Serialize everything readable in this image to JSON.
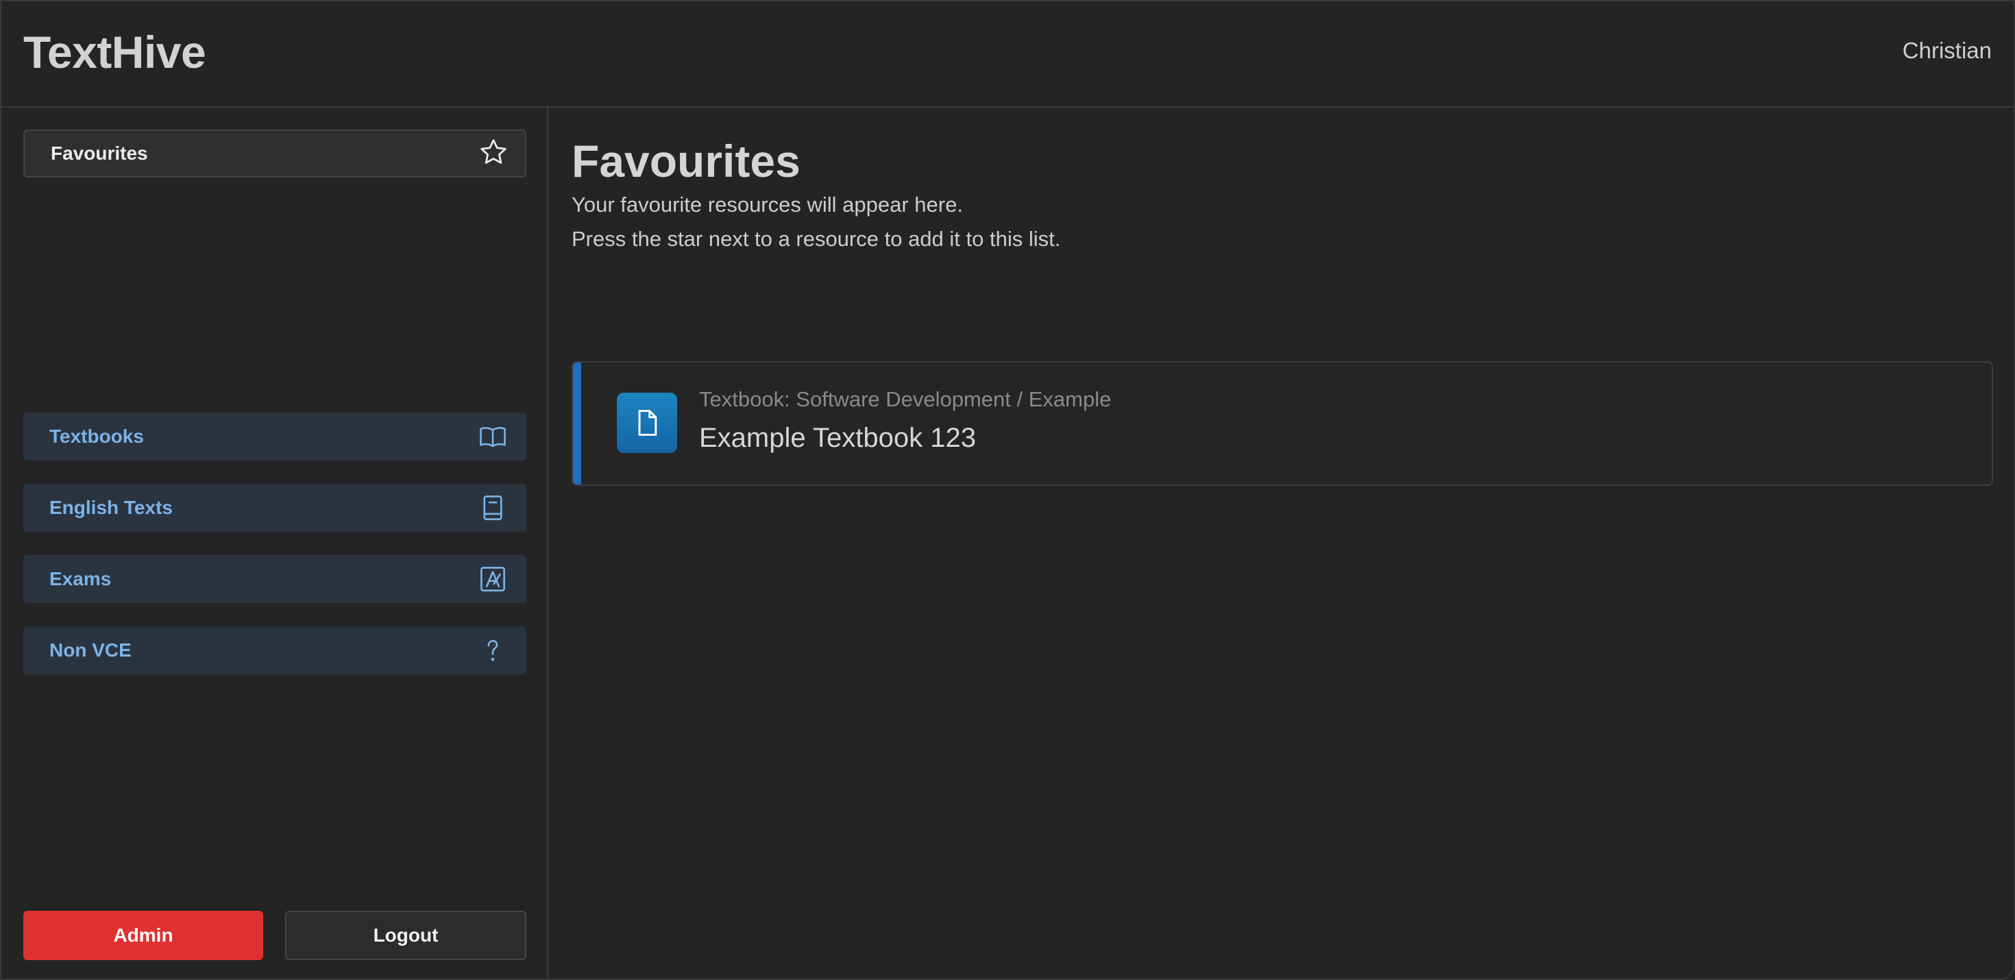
{
  "header": {
    "brand": "TextHive",
    "user_name": "Christian"
  },
  "sidebar": {
    "favourites_label": "Favourites",
    "items": [
      {
        "label": "Textbooks",
        "icon": "book-open-icon"
      },
      {
        "label": "English Texts",
        "icon": "book-icon"
      },
      {
        "label": "Exams",
        "icon": "exam-icon"
      },
      {
        "label": "Non VCE",
        "icon": "question-icon"
      }
    ],
    "admin_label": "Admin",
    "logout_label": "Logout"
  },
  "main": {
    "title": "Favourites",
    "description_lines": [
      "Your favourite resources will appear here.",
      "Press the star next to a resource to add it to this list."
    ],
    "resources": [
      {
        "path": "Textbook: Software Development / Example",
        "title": "Example Textbook 123",
        "icon": "document-icon"
      }
    ]
  },
  "colors": {
    "background": "#242424",
    "nav_item_bg": "#2a3441",
    "nav_item_text": "#7db3e6",
    "admin_button": "#e03131",
    "card_accent": "#1c6fc1",
    "doc_tile": "#1b85c0"
  }
}
